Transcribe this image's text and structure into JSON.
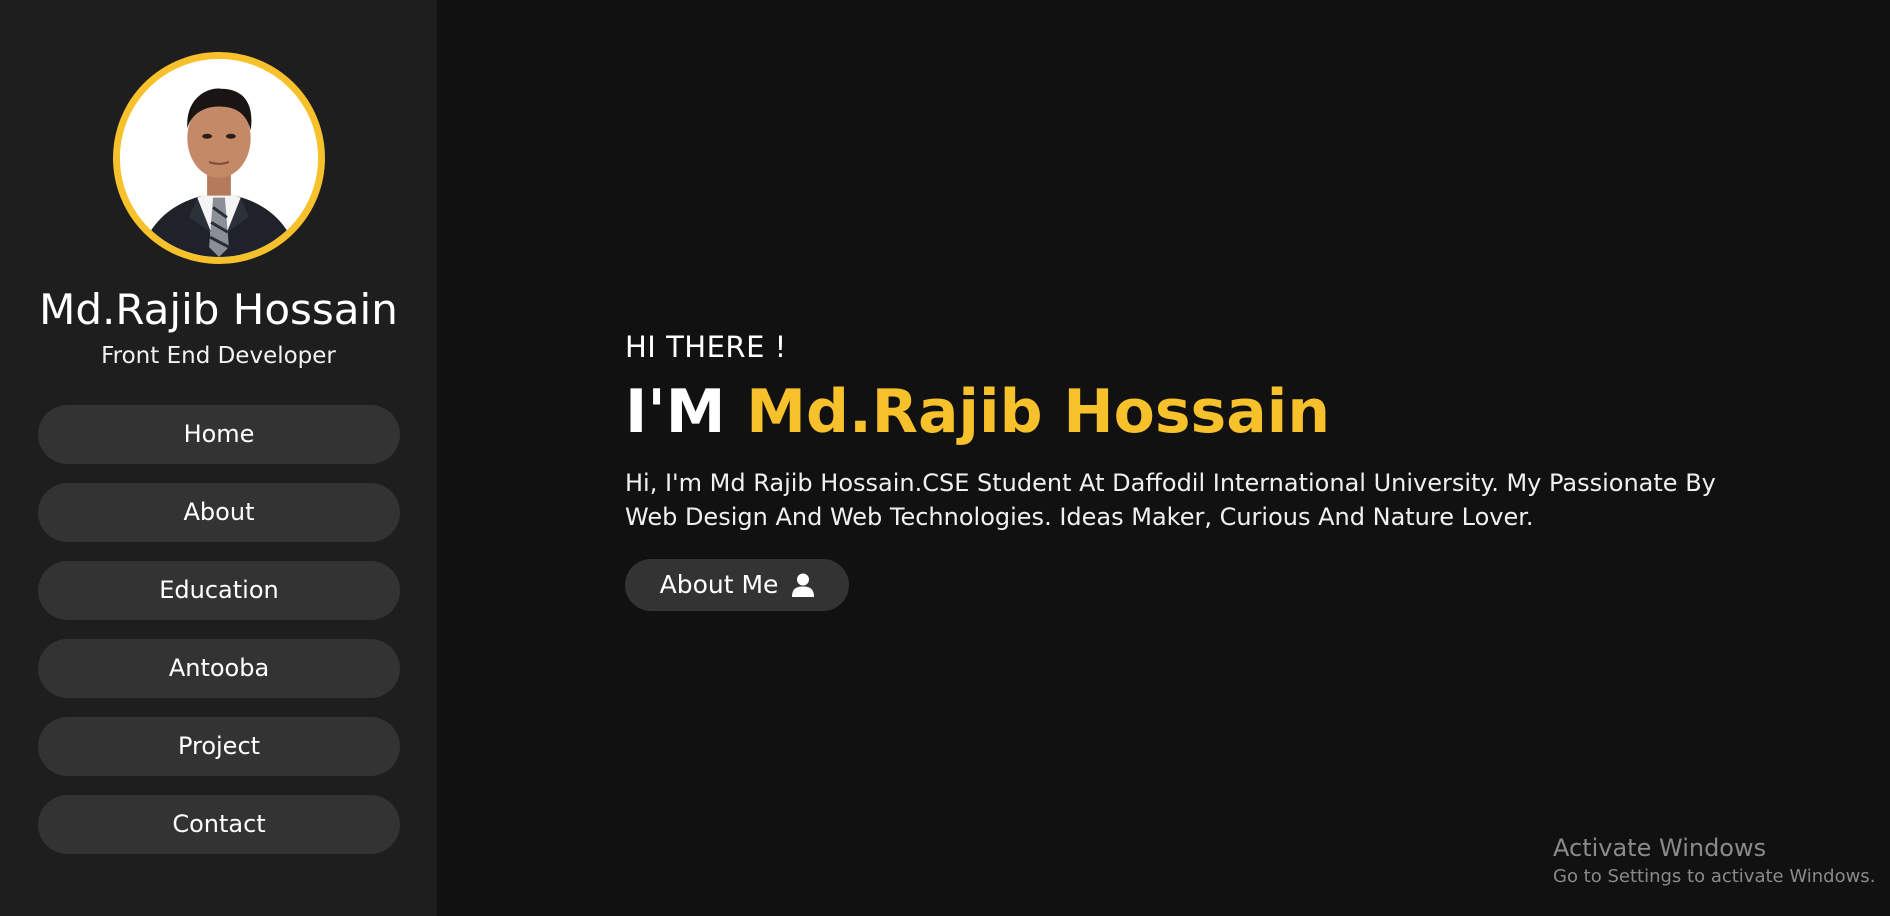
{
  "sidebar": {
    "profile": {
      "name": "Md.Rajib Hossain",
      "role": "Front End Developer"
    },
    "nav": [
      {
        "label": "Home"
      },
      {
        "label": "About"
      },
      {
        "label": "Education"
      },
      {
        "label": "Antooba"
      },
      {
        "label": "Project"
      },
      {
        "label": "Contact"
      }
    ]
  },
  "hero": {
    "greeting": "HI THERE !",
    "prefix": "I'M",
    "name": "Md.Rajib Hossain",
    "bio": "Hi, I'm Md Rajib Hossain.CSE Student At Daffodil International University. My Passionate By Web Design And Web Technologies. Ideas Maker, Curious And Nature Lover.",
    "button_label": "About Me",
    "button_icon": "user-icon"
  },
  "watermark": {
    "title": "Activate Windows",
    "subtitle": "Go to Settings to activate Windows."
  },
  "colors": {
    "accent": "#f7c12b",
    "background": "#111111",
    "sidebar": "#1e1e1e",
    "button": "#333333"
  }
}
